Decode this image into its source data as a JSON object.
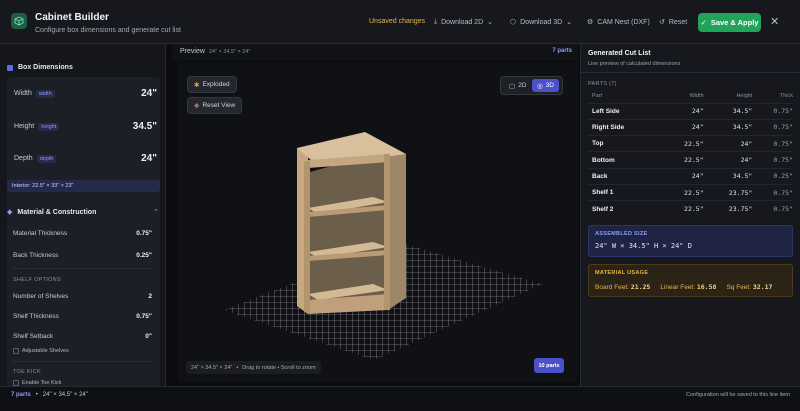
{
  "header": {
    "title": "Cabinet Builder",
    "subtitle": "Configure box dimensions and generate cut list",
    "unsaved": "Unsaved changes",
    "download_2d": "Download 2D",
    "download_3d": "Download 3D",
    "cam_nest": "CAM Nest (DXF)",
    "reset": "Reset",
    "save_apply": "Save & Apply"
  },
  "left": {
    "box_dimensions_title": "Box Dimensions",
    "width": {
      "label": "Width",
      "chip": "width",
      "value": "24\""
    },
    "height": {
      "label": "Height",
      "chip": "height",
      "value": "34.5\""
    },
    "depth": {
      "label": "Depth",
      "chip": "depth",
      "value": "24\""
    },
    "interior": "Interior: 22.5\" × 33\" × 23\"",
    "material_title": "Material & Construction",
    "material_thickness": {
      "label": "Material Thickness",
      "value": "0.75\""
    },
    "back_thickness": {
      "label": "Back Thickness",
      "value": "0.25\""
    },
    "shelf_options": "SHELF OPTIONS",
    "number_of_shelves": {
      "label": "Number of Shelves",
      "value": "2"
    },
    "shelf_thickness": {
      "label": "Shelf Thickness",
      "value": "0.75\""
    },
    "shelf_setback": {
      "label": "Shelf Setback",
      "value": "0\""
    },
    "adjustable_shelves": "Adjustable Shelves",
    "toe_kick": "TOE KICK",
    "enable_toe_kick": "Enable Toe Kick"
  },
  "preview": {
    "title": "Preview",
    "dims": "24\" × 34.5\" × 24\"",
    "parts": "7 parts",
    "exploded": "Exploded",
    "reset_view": "Reset View",
    "toggle_2d": "2D",
    "toggle_3d": "3D",
    "hint_dims": "24\" × 34.5\" × 24\"",
    "hint_text": "Drag to rotate • Scroll to zoom",
    "vp_parts": "10 parts"
  },
  "cutlist": {
    "title": "Generated Cut List",
    "subtitle": "Live preview of calculated dimensions",
    "parts_heading": "PARTS (7)",
    "columns": [
      "Part",
      "Width",
      "Height",
      "Thick"
    ],
    "rows": [
      [
        "Left Side",
        "24\"",
        "34.5\"",
        "0.75\""
      ],
      [
        "Right Side",
        "24\"",
        "34.5\"",
        "0.75\""
      ],
      [
        "Top",
        "22.5\"",
        "24\"",
        "0.75\""
      ],
      [
        "Bottom",
        "22.5\"",
        "24\"",
        "0.75\""
      ],
      [
        "Back",
        "24\"",
        "34.5\"",
        "0.25\""
      ],
      [
        "Shelf 1",
        "22.5\"",
        "23.75\"",
        "0.75\""
      ],
      [
        "Shelf 2",
        "22.5\"",
        "23.75\"",
        "0.75\""
      ]
    ],
    "assembled_heading": "ASSEMBLED SIZE",
    "assembled_value": "24\" W × 34.5\" H × 24\" D",
    "material_heading": "MATERIAL USAGE",
    "board_feet_label": "Board Feet:",
    "board_feet": "21.25",
    "linear_feet_label": "Linear Feet:",
    "linear_feet": "16.58",
    "sq_feet_label": "Sq Feet:",
    "sq_feet": "32.17"
  },
  "footer": {
    "parts": "7 parts",
    "dims": "24\" × 34.5\" × 24\"",
    "note": "Configuration will be saved to this line item"
  },
  "colors": {
    "accent": "#4b52c9",
    "save_green": "#22a35a",
    "warning": "#e3b84a",
    "wood": "#cdb08a"
  }
}
